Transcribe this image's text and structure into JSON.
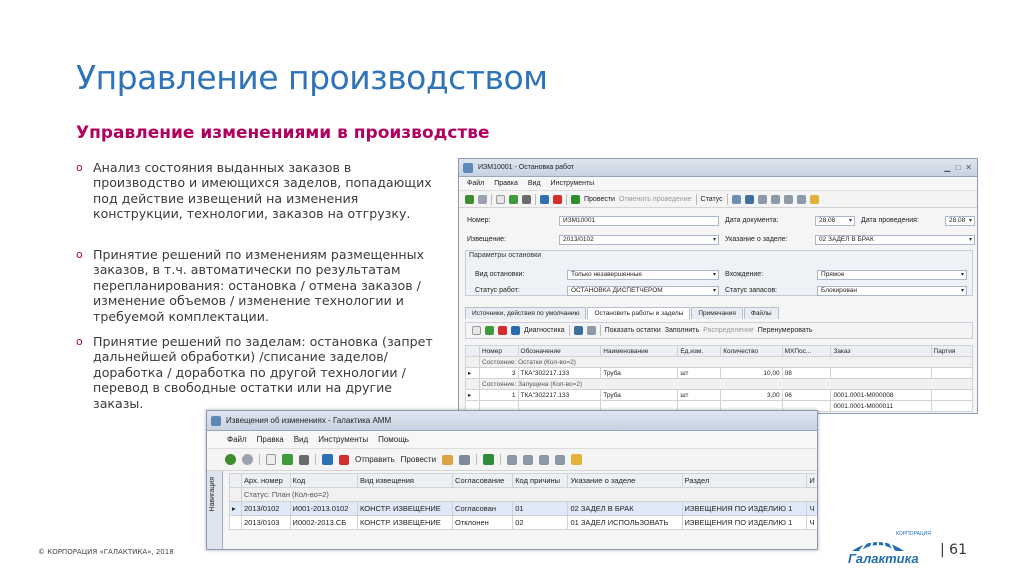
{
  "slide": {
    "title": "Управление производством",
    "subtitle": "Управление изменениями в производстве",
    "bullets": [
      "Анализ состояния выданных заказов в производство и имеющихся заделов, попадающих под действие извещений на изменения конструкции, технологии, заказов на отгрузку.",
      "Принятие решений по изменениям размещенных заказов, в т.ч. автоматически по результатам перепланирования: остановка / отмена заказов / изменение объемов / изменение технологии и требуемой комплектации.",
      "Принятие решений по заделам: остановка (запрет дальнейшей обработки) /списание заделов/ доработка / доработка по другой технологии / перевод в свободные остатки или на другие заказы."
    ],
    "bullet_marker": "o",
    "copyright": "© КОРПОРАЦИЯ «ГАЛАКТИКА», 2018",
    "page": "| 61",
    "logo_text": "Галактика",
    "logo_small": "КОРПОРАЦИЯ"
  },
  "win1": {
    "title": "ИЗМ10001 - Остановка работ",
    "menu": [
      "Файл",
      "Правка",
      "Вид",
      "Инструменты"
    ],
    "toolbar": {
      "post": "Провести",
      "unpost": "Отменить проведение",
      "status": "Статус"
    },
    "labels": {
      "number": "Номер:",
      "notice": "Извещение:",
      "doc_date": "Дата документа:",
      "post_date": "Дата проведения:",
      "reason": "Указание о заделе:",
      "params": "Параметры остановки",
      "stop_kind": "Вид остановки:",
      "work_status": "Статус работ:",
      "entry": "Вхождение:",
      "stock_status": "Статус запасов:"
    },
    "values": {
      "number": "ИЗМ10001",
      "notice": "2013/0102",
      "doc_date": "28.08",
      "post_date": "28.08",
      "reason": "02 ЗАДЕЛ В БРАК",
      "stop_kind": "Только незавершенные",
      "work_status": "ОСТАНОВКА ДИСПЕТЧЕРОМ",
      "entry": "Прямое",
      "stock_status": "Блокирован"
    },
    "tabs": [
      "Источники, действия по умолчанию",
      "Остановить работы и заделы",
      "Примечания",
      "Файлы"
    ],
    "grid_toolbar": {
      "diag": "Диагностика",
      "show": "Показать остатки",
      "fill": "Заполнить",
      "distrib": "Распределение",
      "renumber": "Перенумеровать"
    },
    "columns": [
      "Номер",
      "Обозначение",
      "Наименование",
      "Ед.изм.",
      "Количество",
      "МХПос...",
      "Заказ",
      "Партия"
    ],
    "groups": [
      "Состояние: Остатки (Кол-во=2)",
      "Состояние: Запущена (Кол-во=2)"
    ],
    "rows": [
      [
        "3",
        "ТКА\"302217.133",
        "Труба",
        "шт",
        "10,00",
        "08",
        "",
        ""
      ],
      [
        "1",
        "ТКА\"302217.133",
        "Труба",
        "шт",
        "3,00",
        "06",
        "0001.0001-M000008",
        ""
      ],
      [
        "",
        "",
        "",
        "",
        "",
        "",
        "0001.0001-M000011",
        ""
      ]
    ]
  },
  "win2": {
    "title": "Извещения об изменениях - Галактика AMM",
    "menu": [
      "Файл",
      "Правка",
      "Вид",
      "Инструменты",
      "Помощь"
    ],
    "toolbar": {
      "send": "Отправить",
      "post": "Провести"
    },
    "side_tab": "Навигация",
    "columns": [
      "Арх. номер",
      "Код",
      "Вид извещения",
      "Согласование",
      "Код причины",
      "Указание о заделе",
      "Раздел",
      "И"
    ],
    "group": "Статус: План (Кол-во=2)",
    "rows": [
      [
        "2013/0102",
        "И001-2013.0102",
        "КОНСТР. ИЗВЕЩЕНИЕ",
        "Согласован",
        "01",
        "02 ЗАДЕЛ В БРАК",
        "ИЗВЕЩЕНИЯ ПО ИЗДЕЛИЮ 1",
        "Ч"
      ],
      [
        "2013/0103",
        "И0002-2013.СБ",
        "КОНСТР. ИЗВЕЩЕНИЕ",
        "Отклонен",
        "02",
        "01 ЗАДЕЛ ИСПОЛЬЗОВАТЬ",
        "ИЗВЕЩЕНИЯ ПО ИЗДЕЛИЮ 1",
        "Ч"
      ]
    ]
  },
  "colors": {
    "title": "#2f73b8",
    "accent": "#b1005d",
    "logo": "#1f6fb2"
  }
}
